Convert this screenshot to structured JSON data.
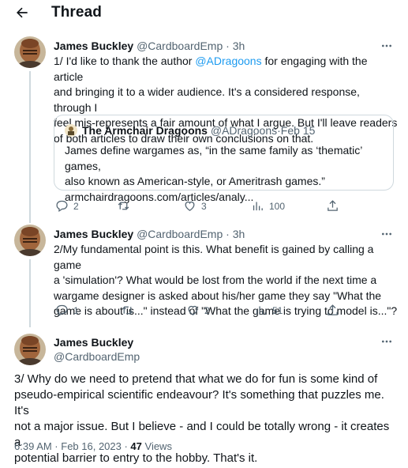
{
  "header": {
    "title": "Thread"
  },
  "tweets": [
    {
      "name": "James Buckley",
      "handle": "@CardboardEmp",
      "separator": " · ",
      "time": "3h",
      "lines": [
        [
          "1/ I'd like to thank the author ",
          "@ADragoons",
          " for engaging with the article"
        ],
        "and bringing it to a wider audience. It's a considered response, through I",
        "feel mis-represents a fair amount of what I argue. But I'll leave readers",
        "of both articles to draw their own conclusions on that."
      ],
      "quote": {
        "name": "The Armchair Dragoons",
        "handle": "@ADragoons",
        "date": "Feb 15",
        "lines": [
          "James define wargames as, “in the same family as ‘thematic’ games,",
          "also known as American-style, or Ameritrash games.”",
          "armchairdragoons.com/articles/analy..."
        ]
      },
      "actions": {
        "replies": "2",
        "retweets": "",
        "likes": "3",
        "views": "100"
      }
    },
    {
      "name": "James Buckley",
      "handle": "@CardboardEmp",
      "separator": " · ",
      "time": "3h",
      "lines": [
        "2/My fundamental point is this. What benefit is gained by calling a game",
        "a 'simulation'? What would be lost from the world if the next time a",
        "wargame designer is asked about his/her game they say \"What the",
        "game is about is...\" instead of \"What the game is trying to model is...\"?"
      ],
      "actions": {
        "replies": "1",
        "retweets": "",
        "likes": "2",
        "views": "51"
      }
    },
    {
      "name": "James Buckley",
      "handle": "@CardboardEmp",
      "lines": [
        "3/ Why do we need to pretend that what we do for fun is some kind of",
        "pseudo-empirical scientific endeavour? It's something that puzzles me. It's",
        "not a major issue. But I believe - and I could be totally wrong - it creates a",
        "potential barrier to entry to the hobby. That's it."
      ],
      "timestamp": "6:39 AM · Feb 16, 2023 · ",
      "views_count": "47",
      "views_label": " Views"
    }
  ],
  "colors": {
    "accent": "#1d9bf0",
    "muted": "#536471",
    "text": "#0f1419",
    "border": "#cfd9de"
  },
  "icons": [
    "back-arrow-icon",
    "more-icon",
    "reply-icon",
    "retweet-icon",
    "like-icon",
    "views-icon",
    "share-icon"
  ]
}
